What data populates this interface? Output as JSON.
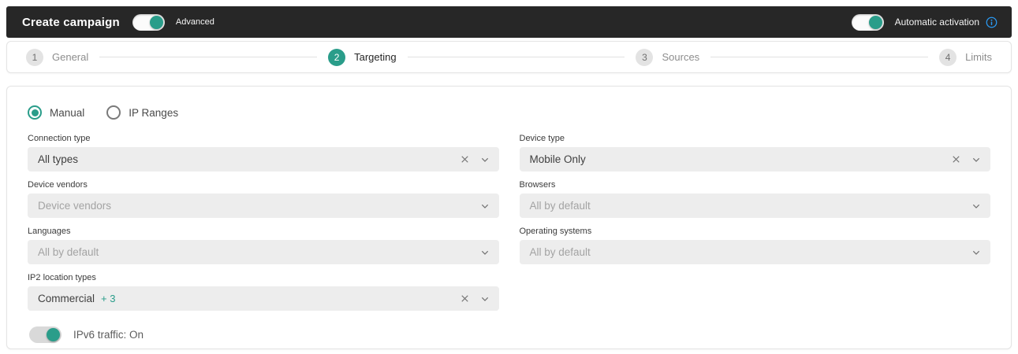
{
  "colors": {
    "accent": "#2a9d8a",
    "header_bg": "#272727",
    "info": "#2a9af3"
  },
  "header": {
    "title": "Create campaign",
    "advanced_toggle": {
      "label": "Advanced",
      "on": true
    },
    "auto_activation_toggle": {
      "label": "Automatic activation",
      "on": true
    }
  },
  "stepper": {
    "steps": [
      {
        "number": "1",
        "label": "General",
        "active": false
      },
      {
        "number": "2",
        "label": "Targeting",
        "active": true
      },
      {
        "number": "3",
        "label": "Sources",
        "active": false
      },
      {
        "number": "4",
        "label": "Limits",
        "active": false
      }
    ]
  },
  "form": {
    "mode_radios": [
      {
        "label": "Manual",
        "selected": true
      },
      {
        "label": "IP Ranges",
        "selected": false
      }
    ],
    "fields": {
      "connection_type": {
        "label": "Connection type",
        "value": "All types",
        "clearable": true
      },
      "device_type": {
        "label": "Device type",
        "value": "Mobile Only",
        "clearable": true
      },
      "device_vendors": {
        "label": "Device vendors",
        "placeholder": "Device vendors"
      },
      "browsers": {
        "label": "Browsers",
        "placeholder": "All by default"
      },
      "languages": {
        "label": "Languages",
        "placeholder": "All by default"
      },
      "operating_systems": {
        "label": "Operating systems",
        "placeholder": "All by default"
      },
      "ip2_location_types": {
        "label": "IP2 location types",
        "value": "Commercial",
        "extra_badge": "+ 3",
        "clearable": true
      }
    },
    "ipv6_toggle": {
      "label": "IPv6 traffic: On",
      "on": true
    }
  }
}
